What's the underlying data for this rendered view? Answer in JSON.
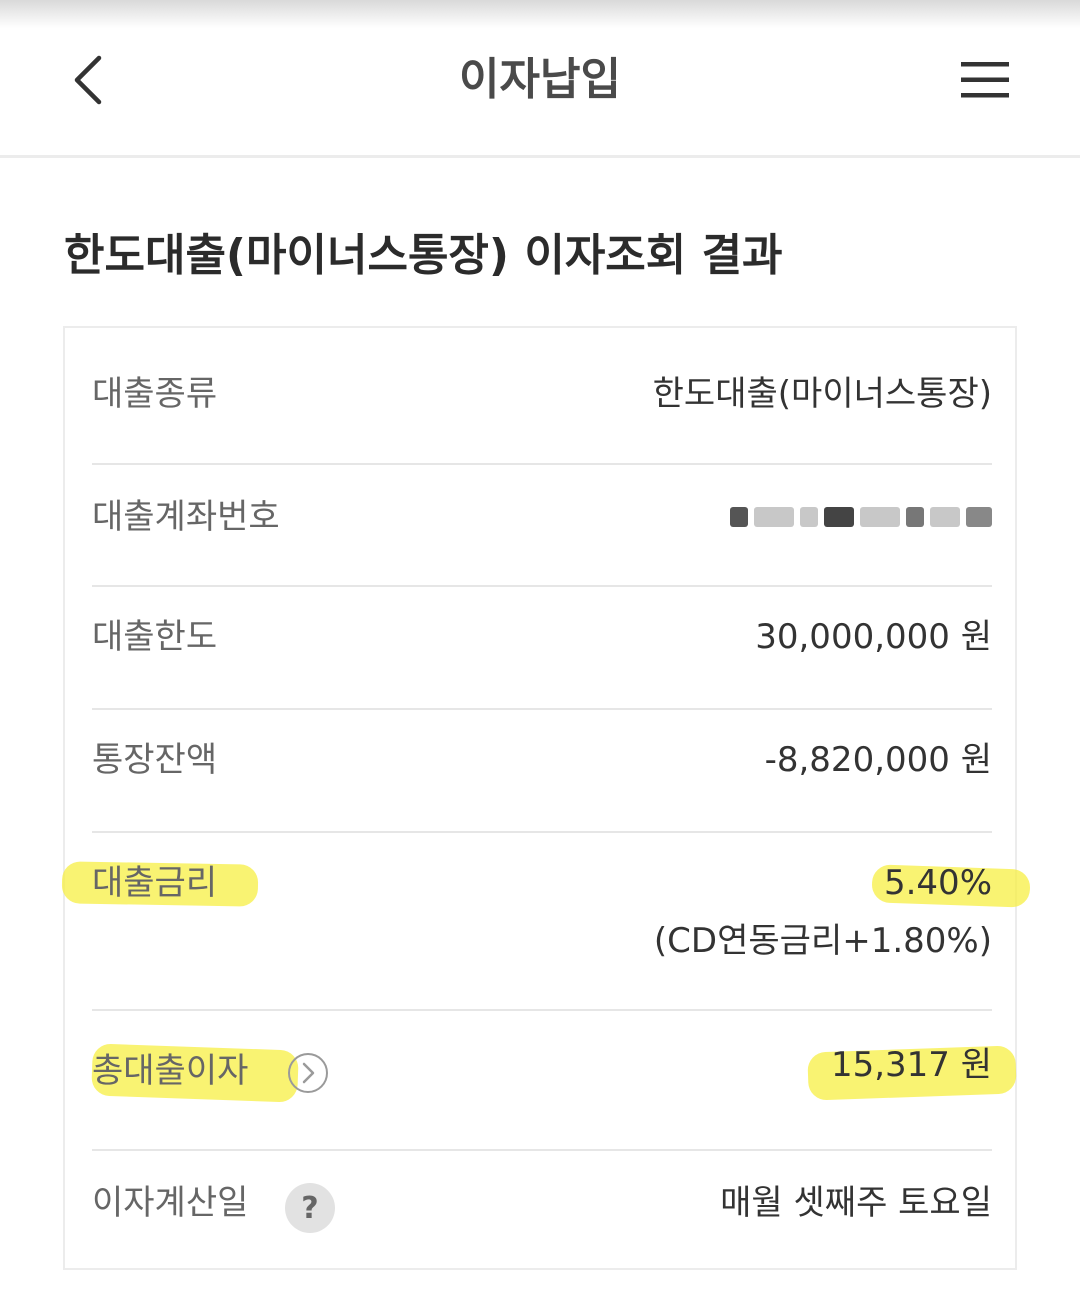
{
  "header": {
    "title": "이자납입",
    "back_icon": "chevron-left-icon",
    "menu_icon": "hamburger-menu-icon"
  },
  "result_title": "한도대출(마이너스통장) 이자조회 결과",
  "rows": {
    "loan_type": {
      "label": "대출종류",
      "value": "한도대출(마이너스통장)"
    },
    "account_number": {
      "label": "대출계좌번호"
    },
    "loan_limit": {
      "label": "대출한도",
      "value": "30,000,000 원"
    },
    "balance": {
      "label": "통장잔액",
      "value": "-8,820,000 원"
    },
    "interest_rate": {
      "label": "대출금리",
      "value": "5.40%",
      "sub_value": "(CD연동금리+1.80%)"
    },
    "total_interest": {
      "label": "총대출이자",
      "value": "15,317 원",
      "icon": "chevron-right-circle-icon"
    },
    "interest_date": {
      "label": "이자계산일",
      "value": "매월 셋째주 토요일",
      "help_symbol": "?"
    }
  },
  "colors": {
    "highlight": "#f6ee3c",
    "divider": "#e6e6e6",
    "label_text": "#666666",
    "value_text": "#333333"
  }
}
